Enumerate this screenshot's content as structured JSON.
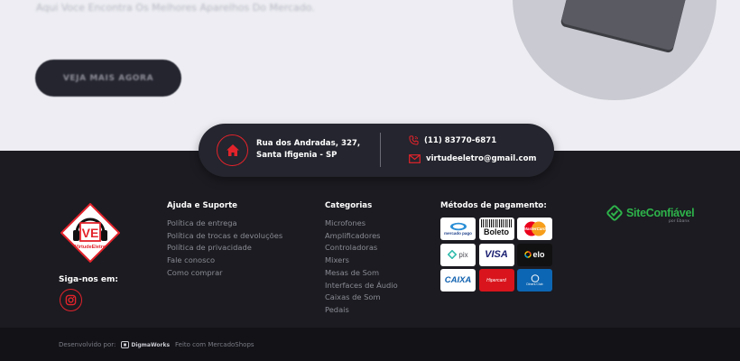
{
  "hero": {
    "intro_text": "Aqui Voce Encontra Os Melhores Aparelhos Do Mercado.",
    "button_label": "VEJA MAIS AGORA"
  },
  "contact": {
    "address_line1": "Rua dos Andradas, 327,",
    "address_line2": "Santa Ifigenia - SP",
    "phone": "(11) 83770-6871",
    "email": "virtudeeletro@gmail.com"
  },
  "footer": {
    "logo_text": "VirtudeEletro",
    "follow_label": "Siga-nos em:",
    "help": {
      "title": "Ajuda e Suporte",
      "links": [
        "Política de entrega",
        "Política de trocas e devoluções",
        "Política de privacidade",
        "Fale conosco",
        "Como comprar"
      ]
    },
    "categories": {
      "title": "Categorias",
      "links": [
        "Microfones",
        "Amplificadores",
        "Controladoras",
        "Mixers",
        "Mesas de Som",
        "Interfaces de Áudio",
        "Caixas de Som",
        "Pedais"
      ]
    },
    "payment": {
      "title": "Métodos de pagamento:",
      "methods": [
        "mercado pago",
        "Boleto",
        "MasterCard",
        "pix",
        "VISA",
        "elo",
        "CAIXA",
        "Hipercard",
        "Diners Club"
      ]
    },
    "trust_badge": {
      "name": "SiteConfiável",
      "tagline": "por Ebanx"
    }
  },
  "bottom": {
    "developed_by": "Desenvolvido por:",
    "developer": "DigmaWorks",
    "made_with": "Feito com MercadoShops"
  },
  "colors": {
    "accent_red": "#e3232b",
    "footer_bg": "#1b1b21",
    "hero_bg": "#ededf3",
    "trust_green": "#2eb34a"
  }
}
